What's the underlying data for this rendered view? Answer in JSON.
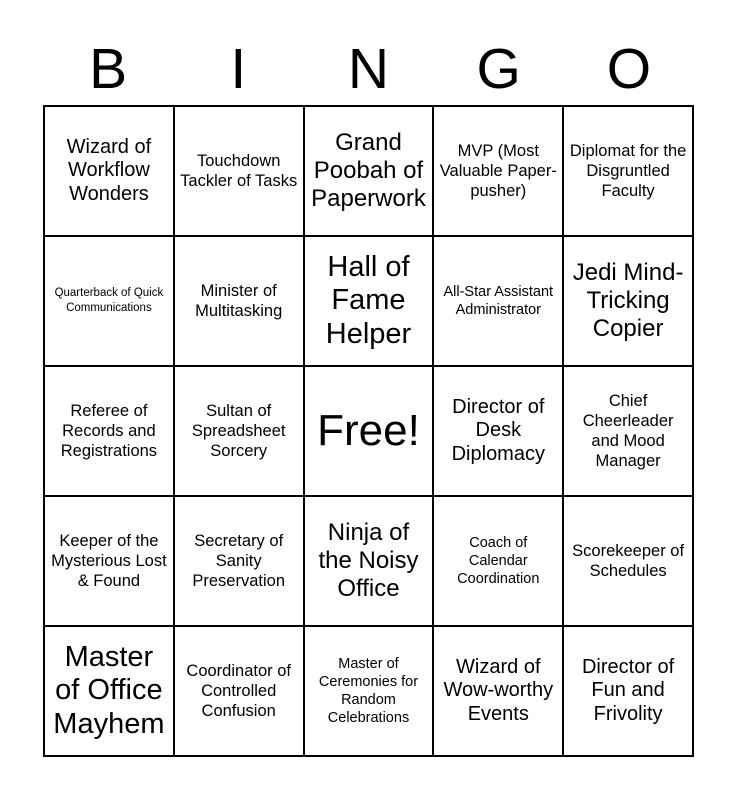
{
  "header": {
    "letters": [
      "B",
      "I",
      "N",
      "G",
      "O"
    ]
  },
  "grid": {
    "rows": 5,
    "columns": 5,
    "border_color": "#000000",
    "background_color": "#ffffff",
    "text_color": "#000000",
    "cells": [
      [
        {
          "text": "Wizard of Workflow Wonders",
          "size": "lg"
        },
        {
          "text": "Touchdown Tackler of Tasks",
          "size": "md"
        },
        {
          "text": "Grand Poobah of Paperwork",
          "size": "xl"
        },
        {
          "text": "MVP (Most Valuable Paper-pusher)",
          "size": "md"
        },
        {
          "text": "Diplomat for the Disgruntled Faculty",
          "size": "md"
        }
      ],
      [
        {
          "text": "Quarterback of Quick Communications",
          "size": "xs"
        },
        {
          "text": "Minister of Multitasking",
          "size": "md"
        },
        {
          "text": "Hall of Fame Helper",
          "size": "xxl"
        },
        {
          "text": "All-Star Assistant Administrator",
          "size": "sm"
        },
        {
          "text": "Jedi Mind-Tricking Copier",
          "size": "xl"
        }
      ],
      [
        {
          "text": "Referee of Records and Registrations",
          "size": "md"
        },
        {
          "text": "Sultan of Spreadsheet Sorcery",
          "size": "md"
        },
        {
          "text": "Free!",
          "size": "free"
        },
        {
          "text": "Director of Desk Diplomacy",
          "size": "lg"
        },
        {
          "text": "Chief Cheerleader and Mood Manager",
          "size": "md"
        }
      ],
      [
        {
          "text": "Keeper of the Mysterious Lost & Found",
          "size": "md"
        },
        {
          "text": "Secretary of Sanity Preservation",
          "size": "md"
        },
        {
          "text": "Ninja of the Noisy Office",
          "size": "xl"
        },
        {
          "text": "Coach of Calendar Coordination",
          "size": "sm"
        },
        {
          "text": "Scorekeeper of Schedules",
          "size": "md"
        }
      ],
      [
        {
          "text": "Master of Office Mayhem",
          "size": "xxl"
        },
        {
          "text": "Coordinator of Controlled Confusion",
          "size": "md"
        },
        {
          "text": "Master of Ceremonies for Random Celebrations",
          "size": "sm"
        },
        {
          "text": "Wizard of Wow-worthy Events",
          "size": "lg"
        },
        {
          "text": "Director of Fun and Frivolity",
          "size": "lg"
        }
      ]
    ]
  }
}
